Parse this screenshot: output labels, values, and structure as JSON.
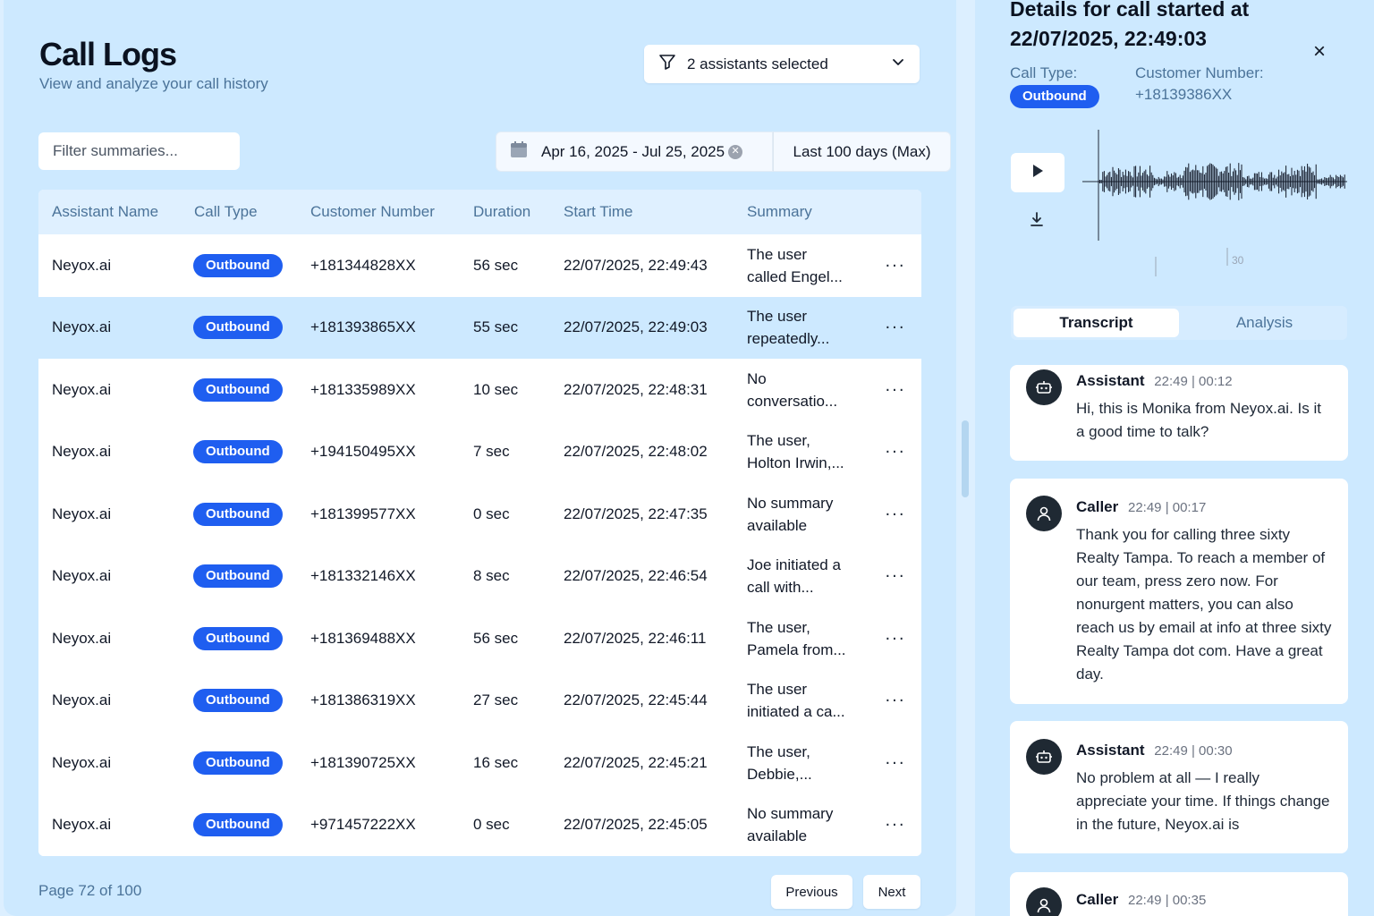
{
  "header": {
    "title": "Call Logs",
    "subtitle": "View and analyze your call history",
    "assistant_filter": "2 assistants selected"
  },
  "filters": {
    "summary_placeholder": "Filter summaries...",
    "date_range": "Apr 16, 2025 - Jul 25, 2025",
    "preset": "Last 100 days (Max)"
  },
  "table": {
    "columns": [
      "Assistant Name",
      "Call Type",
      "Customer Number",
      "Duration",
      "Start Time",
      "Summary"
    ],
    "rows": [
      {
        "assistant": "Neyox.ai",
        "type": "Outbound",
        "number": "+181344828XX",
        "duration": "56 sec",
        "start": "22/07/2025, 22:49:43",
        "summary_1": "The user",
        "summary_2": "called Engel..."
      },
      {
        "assistant": "Neyox.ai",
        "type": "Outbound",
        "number": "+181393865XX",
        "duration": "55 sec",
        "start": "22/07/2025, 22:49:03",
        "summary_1": "The user",
        "summary_2": "repeatedly..."
      },
      {
        "assistant": "Neyox.ai",
        "type": "Outbound",
        "number": "+181335989XX",
        "duration": "10 sec",
        "start": "22/07/2025, 22:48:31",
        "summary_1": "No",
        "summary_2": "conversatio..."
      },
      {
        "assistant": "Neyox.ai",
        "type": "Outbound",
        "number": "+194150495XX",
        "duration": "7 sec",
        "start": "22/07/2025, 22:48:02",
        "summary_1": "The user,",
        "summary_2": "Holton Irwin,..."
      },
      {
        "assistant": "Neyox.ai",
        "type": "Outbound",
        "number": "+181399577XX",
        "duration": "0 sec",
        "start": "22/07/2025, 22:47:35",
        "summary_1": "No summary",
        "summary_2": "available"
      },
      {
        "assistant": "Neyox.ai",
        "type": "Outbound",
        "number": "+181332146XX",
        "duration": "8 sec",
        "start": "22/07/2025, 22:46:54",
        "summary_1": "Joe initiated a",
        "summary_2": "call with..."
      },
      {
        "assistant": "Neyox.ai",
        "type": "Outbound",
        "number": "+181369488XX",
        "duration": "56 sec",
        "start": "22/07/2025, 22:46:11",
        "summary_1": "The user,",
        "summary_2": "Pamela from..."
      },
      {
        "assistant": "Neyox.ai",
        "type": "Outbound",
        "number": "+181386319XX",
        "duration": "27 sec",
        "start": "22/07/2025, 22:45:44",
        "summary_1": "The user",
        "summary_2": "initiated a ca..."
      },
      {
        "assistant": "Neyox.ai",
        "type": "Outbound",
        "number": "+181390725XX",
        "duration": "16 sec",
        "start": "22/07/2025, 22:45:21",
        "summary_1": "The user,",
        "summary_2": "Debbie,..."
      },
      {
        "assistant": "Neyox.ai",
        "type": "Outbound",
        "number": "+971457222XX",
        "duration": "0 sec",
        "start": "22/07/2025, 22:45:05",
        "summary_1": "No summary",
        "summary_2": "available"
      }
    ],
    "more_label": "···",
    "selected_row": 1
  },
  "pagination": {
    "text": "Page 72 of 100",
    "previous": "Previous",
    "next": "Next"
  },
  "details": {
    "title": "Details for call started at 22/07/2025, 22:49:03",
    "close": "×",
    "call_type_label": "Call Type:",
    "call_type": "Outbound",
    "customer_label": "Customer Number:",
    "customer_number": "+18139386XX",
    "waveform_tick": "30",
    "tabs": [
      "Transcript",
      "Analysis"
    ],
    "active_tab": "Transcript",
    "messages": [
      {
        "role": "Assistant",
        "time": "22:49 | 00:12",
        "text": "Hi, this is Monika from Neyox.ai. Is it a good time to talk?"
      },
      {
        "role": "Caller",
        "time": "22:49 | 00:17",
        "text": "Thank you for calling three sixty Realty Tampa. To reach a member of our team, press zero now. For nonurgent matters, you can also reach us by email at info at three sixty Realty Tampa dot com. Have a great day."
      },
      {
        "role": "Assistant",
        "time": "22:49 | 00:30",
        "text": "No problem at all — I really appreciate your time. If things change in the future, Neyox.ai is"
      },
      {
        "role": "Caller",
        "time": "22:49 | 00:35",
        "text": ""
      }
    ]
  },
  "colors": {
    "accent": "#1f5ef0",
    "panel": "#cde9ff",
    "muted_text": "#4b7399"
  },
  "icons": {
    "filter": "funnel-icon",
    "dropdown": "chevron-down-icon",
    "calendar": "calendar-icon",
    "clear": "clear-icon",
    "play": "play-icon",
    "download": "download-icon",
    "close": "close-icon",
    "assistant_avatar": "robot-icon",
    "caller_avatar": "user-icon"
  }
}
